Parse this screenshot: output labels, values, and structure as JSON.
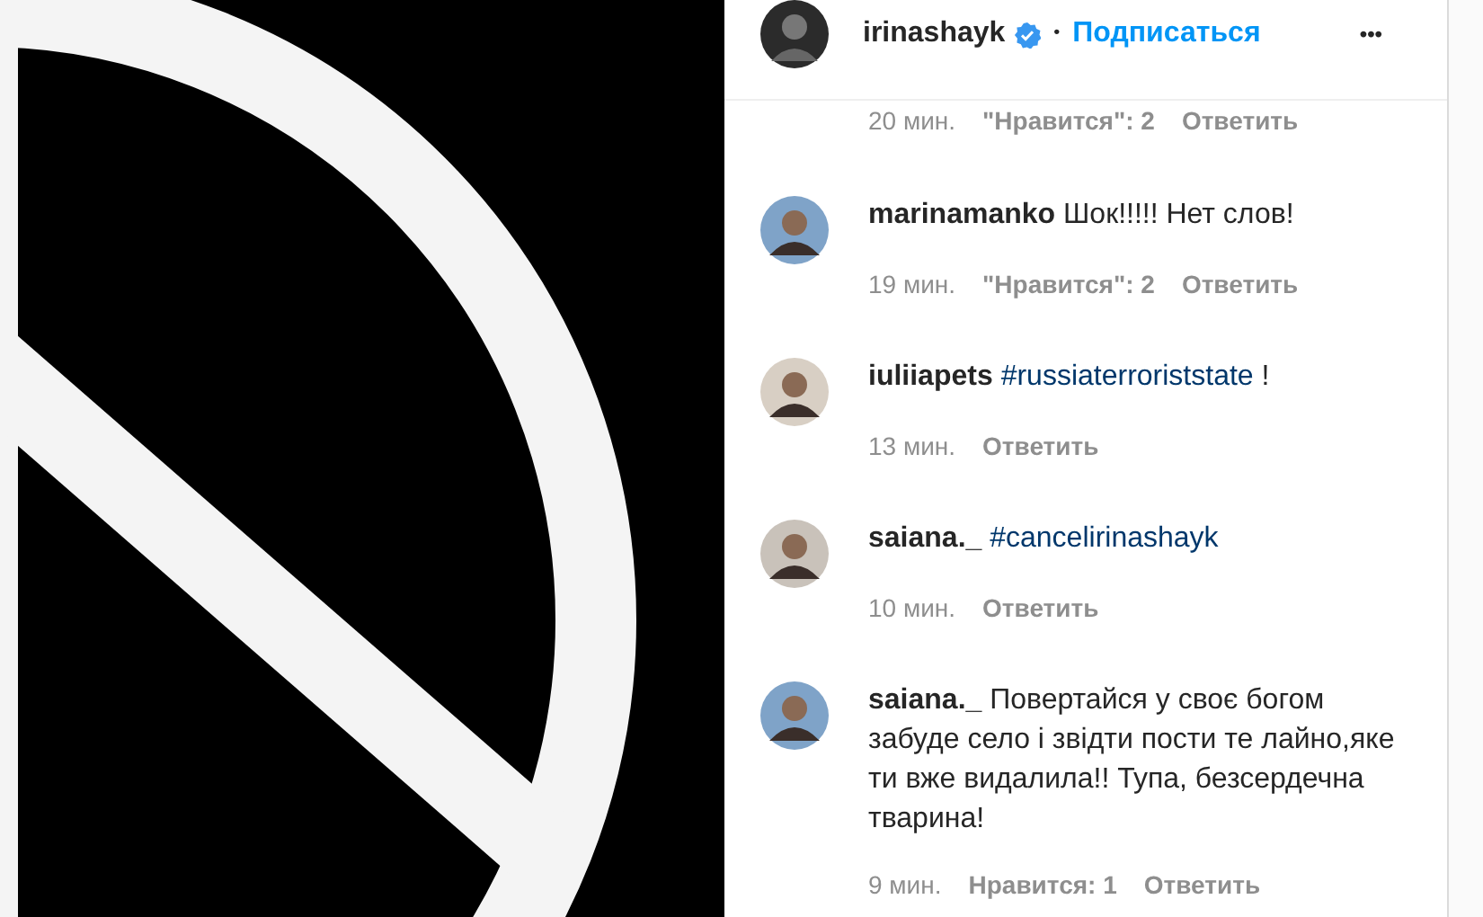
{
  "header": {
    "username": "irinashayk",
    "verified": true,
    "separator": "•",
    "follow": "Подписаться",
    "more": "•••"
  },
  "comments": [
    {
      "time": "20 мин.",
      "likes": "\"Нравится\": 2",
      "reply": "Ответить"
    },
    {
      "username": "marinamanko",
      "parts": [
        {
          "kind": "plain",
          "text": "Шок!!!!! Нет слов!"
        }
      ],
      "time": "19 мин.",
      "likes": "\"Нравится\": 2",
      "reply": "Ответить"
    },
    {
      "username": "iuliiapets",
      "parts": [
        {
          "kind": "hashtag",
          "text": "#russiaterroriststate"
        },
        {
          "kind": "plain",
          "text": "!"
        }
      ],
      "time": "13 мин.",
      "reply": "Ответить"
    },
    {
      "username": "saiana._",
      "parts": [
        {
          "kind": "hashtag",
          "text": "#cancelirinashayk"
        }
      ],
      "time": "10 мин.",
      "reply": "Ответить"
    },
    {
      "username": "saiana._",
      "parts": [
        {
          "kind": "plain",
          "text": "Повертайся у своє богом забуде село і звідти пости те лайно,яке ти вже видалила!! Тупа, безсердечна тварина!"
        }
      ],
      "time": "9 мин.",
      "likes": "Нравится: 1",
      "reply": "Ответить"
    }
  ]
}
